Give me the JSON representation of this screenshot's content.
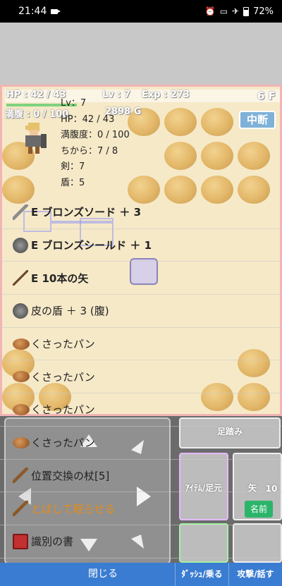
{
  "status_bar": {
    "time": "21:44",
    "battery": "72%"
  },
  "hud": {
    "hp": "HP : 42 / 43",
    "lv": "Lv : 7",
    "exp": "Exp : 273",
    "floor": "6 F",
    "hunger": "満腹 : 0 / 100",
    "gold": "2898 G",
    "pause_label": "中断"
  },
  "stats": {
    "lv": "Lv：7",
    "hp": "HP：42 / 43",
    "hunger": "満腹度：0 / 100",
    "power": "ちから：7 / 8",
    "sword": "剣：7",
    "shield": "盾：5"
  },
  "items": [
    {
      "label": "E ブロンズソード ＋ 3",
      "icon": "sword-icon",
      "equipped": true
    },
    {
      "label": "E ブロンズシールド ＋ 1",
      "icon": "shield-icon",
      "equipped": true
    },
    {
      "label": "E 10本の矢",
      "icon": "arrow-icon",
      "equipped": true
    },
    {
      "label": "皮の盾 ＋ 3 (腹)",
      "icon": "shield-icon",
      "equipped": false
    },
    {
      "label": "くさったパン",
      "icon": "bread-icon",
      "equipped": false
    },
    {
      "label": "くさったパン",
      "icon": "bread-icon",
      "equipped": false
    },
    {
      "label": "くさったパン",
      "icon": "bread-icon",
      "equipped": false
    },
    {
      "label": "くさったパン",
      "icon": "bread-icon",
      "equipped": false
    },
    {
      "label": "位置交換の杖[5]",
      "icon": "staff-icon",
      "equipped": false
    },
    {
      "label": "とばして眠らせる",
      "icon": "staff-icon",
      "equipped": false,
      "selected": true
    },
    {
      "label": "識別の書",
      "icon": "book-icon",
      "equipped": false
    }
  ],
  "controls": {
    "step_label": "足踏み",
    "item_label": "ｱｲﾃﾑ/足元",
    "arrow_label": "矢",
    "arrow_count": "10",
    "name_label": "名前",
    "dash_label": "ﾀﾞｯｼｭ/乗る",
    "attack_label": "攻撃/話す",
    "close_label": "閉じる"
  },
  "colors": {
    "accent_blue": "#3a7cd1",
    "selected_orange": "#e48b19",
    "field_bg": "#f6e9c8"
  }
}
